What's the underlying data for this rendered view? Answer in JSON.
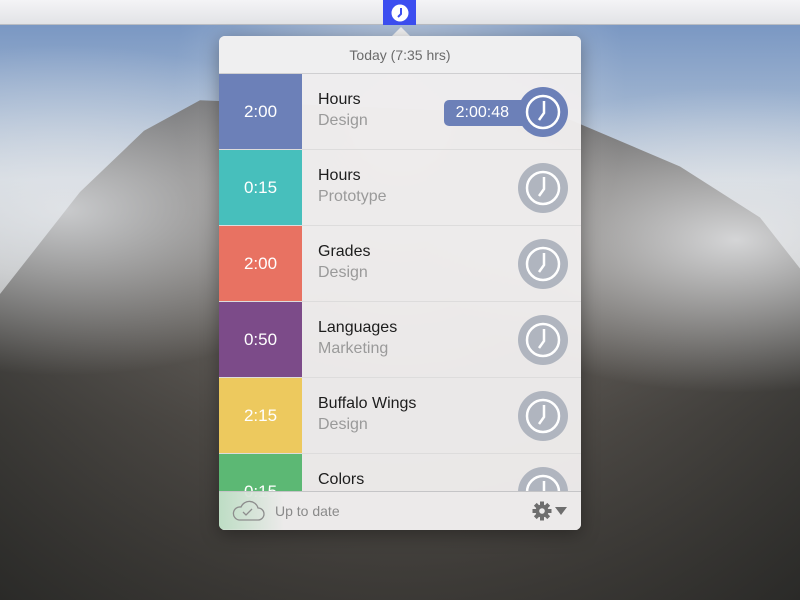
{
  "menubar": {
    "icon": "clock-icon",
    "accent": "#3c4ef0"
  },
  "header": {
    "title": "Today (7:35 hrs)"
  },
  "entries": [
    {
      "time": "2:00",
      "title": "Hours",
      "subtitle": "Design",
      "color": "#6c80b8",
      "running": true,
      "timer": "2:00:48"
    },
    {
      "time": "0:15",
      "title": "Hours",
      "subtitle": "Prototype",
      "color": "#47bfbc",
      "running": false
    },
    {
      "time": "2:00",
      "title": "Grades",
      "subtitle": "Design",
      "color": "#e87262",
      "running": false
    },
    {
      "time": "0:50",
      "title": "Languages",
      "subtitle": "Marketing",
      "color": "#7c4b89",
      "running": false
    },
    {
      "time": "2:15",
      "title": "Buffalo Wings",
      "subtitle": "Design",
      "color": "#edc95e",
      "running": false
    },
    {
      "time": "0:15",
      "title": "Colors",
      "subtitle": "",
      "color": "#5cb874",
      "running": false
    }
  ],
  "footer": {
    "status": "Up to date",
    "status_icon": "cloud-check-icon",
    "settings_icon": "gear-icon"
  }
}
